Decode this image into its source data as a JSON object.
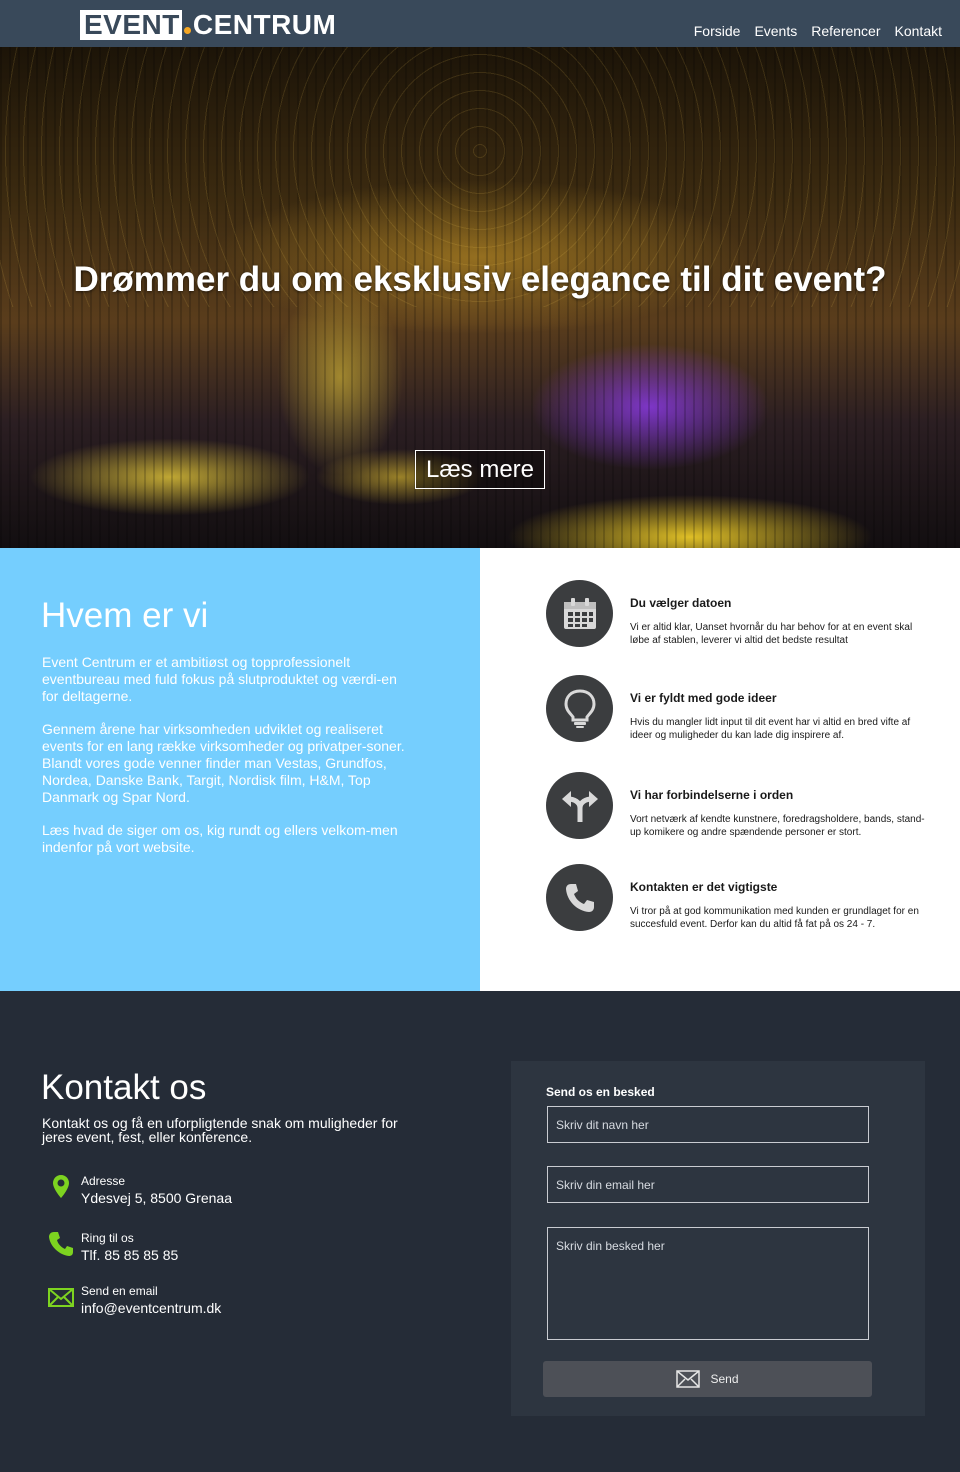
{
  "brand": {
    "part1": "EVENT",
    "part2": "CENTRUM"
  },
  "nav": {
    "items": [
      "Forside",
      "Events",
      "Referencer",
      "Kontakt"
    ]
  },
  "hero": {
    "title": "Drømmer du om eksklusiv elegance til dit event?",
    "button": "Læs mere"
  },
  "about": {
    "title": "Hvem er vi",
    "paragraphs": [
      "Event Centrum er et ambitiøst og topprofessionelt eventbureau med fuld fokus på slutproduktet og værdi-en for deltagerne.",
      "Gennem årene har virksomheden udviklet og realiseret events for en lang række virksomheder og privatper-soner. Blandt vores gode venner finder man Vestas, Grundfos, Nordea, Danske Bank, Targit, Nordisk film, H&M, Top Danmark og Spar Nord.",
      "Læs hvad de siger om os, kig rundt og ellers velkom-men indenfor på vort website."
    ]
  },
  "features": [
    {
      "icon": "calendar-icon",
      "title": "Du vælger datoen",
      "text": "Vi er altid klar, Uanset hvornår du har behov for at en event skal løbe af stablen, leverer vi altid det bedste resultat"
    },
    {
      "icon": "lightbulb-icon",
      "title": "Vi er fyldt med gode ideer",
      "text": "Hvis du mangler lidt input til dit event har vi altid en bred vifte af ideer og muligheder du kan lade dig inspirere af."
    },
    {
      "icon": "arrows-split-icon",
      "title": "Vi har forbindelserne i orden",
      "text": "Vort netværk af kendte kunstnere, foredragsholdere, bands, stand-up komikere og andre spændende personer er stort."
    },
    {
      "icon": "phone-icon",
      "title": "Kontakten er det vigtigste",
      "text": "Vi tror på at god kommunikation med kunden er grundlaget for en succesfuld event. Derfor kan du altid få fat på os 24 - 7."
    }
  ],
  "contact": {
    "title": "Kontakt os",
    "lead": "Kontakt os og få en uforpligtende snak om muligheder for jeres event, fest, eller konference.",
    "address": {
      "label": "Adresse",
      "value": "Ydesvej 5, 8500 Grenaa"
    },
    "phone": {
      "label": "Ring til os",
      "value": "Tlf. 85 85 85 85"
    },
    "email": {
      "label": "Send en email",
      "value": "info@eventcentrum.dk"
    }
  },
  "form": {
    "title": "Send os en besked",
    "name_placeholder": "Skriv dit navn her",
    "email_placeholder": "Skriv din email her",
    "message_placeholder": "Skriv din besked her",
    "send_label": "Send"
  },
  "colors": {
    "header": "#39495a",
    "about_bg": "#75cefe",
    "footer_bg": "#252c37",
    "form_bg": "#2d3540",
    "icon_accent": "#7dd320",
    "logo_dot": "#f5a623"
  }
}
